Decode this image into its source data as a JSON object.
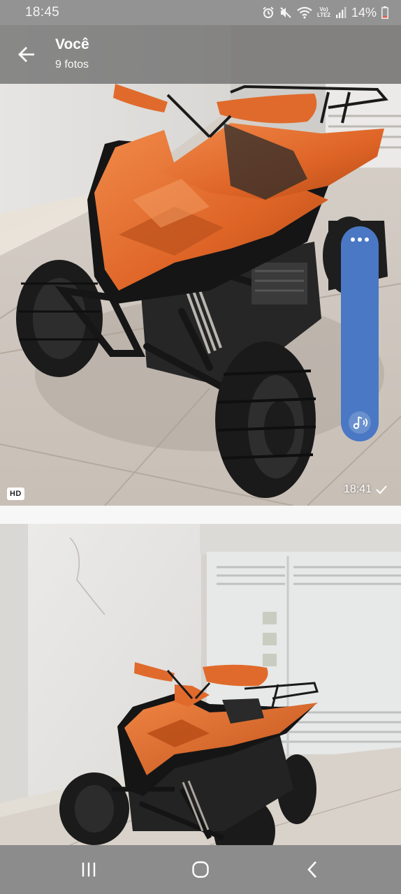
{
  "status_bar": {
    "time": "18:45",
    "network": "LTE2",
    "network_top": "Vo)",
    "battery": "14%",
    "icons": [
      "alarm-icon",
      "mute-icon",
      "wifi-icon",
      "signal-icon",
      "battery-icon"
    ]
  },
  "header": {
    "title": "Você",
    "subtitle": "9 fotos",
    "back_icon": "arrow-left-icon"
  },
  "messages": [
    {
      "type": "photo",
      "quality_badge": "HD",
      "time": "18:41",
      "status_icon": "check-icon"
    },
    {
      "type": "photo"
    }
  ],
  "side_panel": {
    "menu_icon": "dots-icon",
    "action_icon": "audio-note-icon"
  },
  "nav_bar": {
    "buttons": [
      "recents-icon",
      "home-icon",
      "back-icon"
    ]
  },
  "colors": {
    "accent": "#4a78c4",
    "atv_orange": "#e06a2c",
    "status_bar": "#939393",
    "nav_bar": "#8c8c8c"
  }
}
